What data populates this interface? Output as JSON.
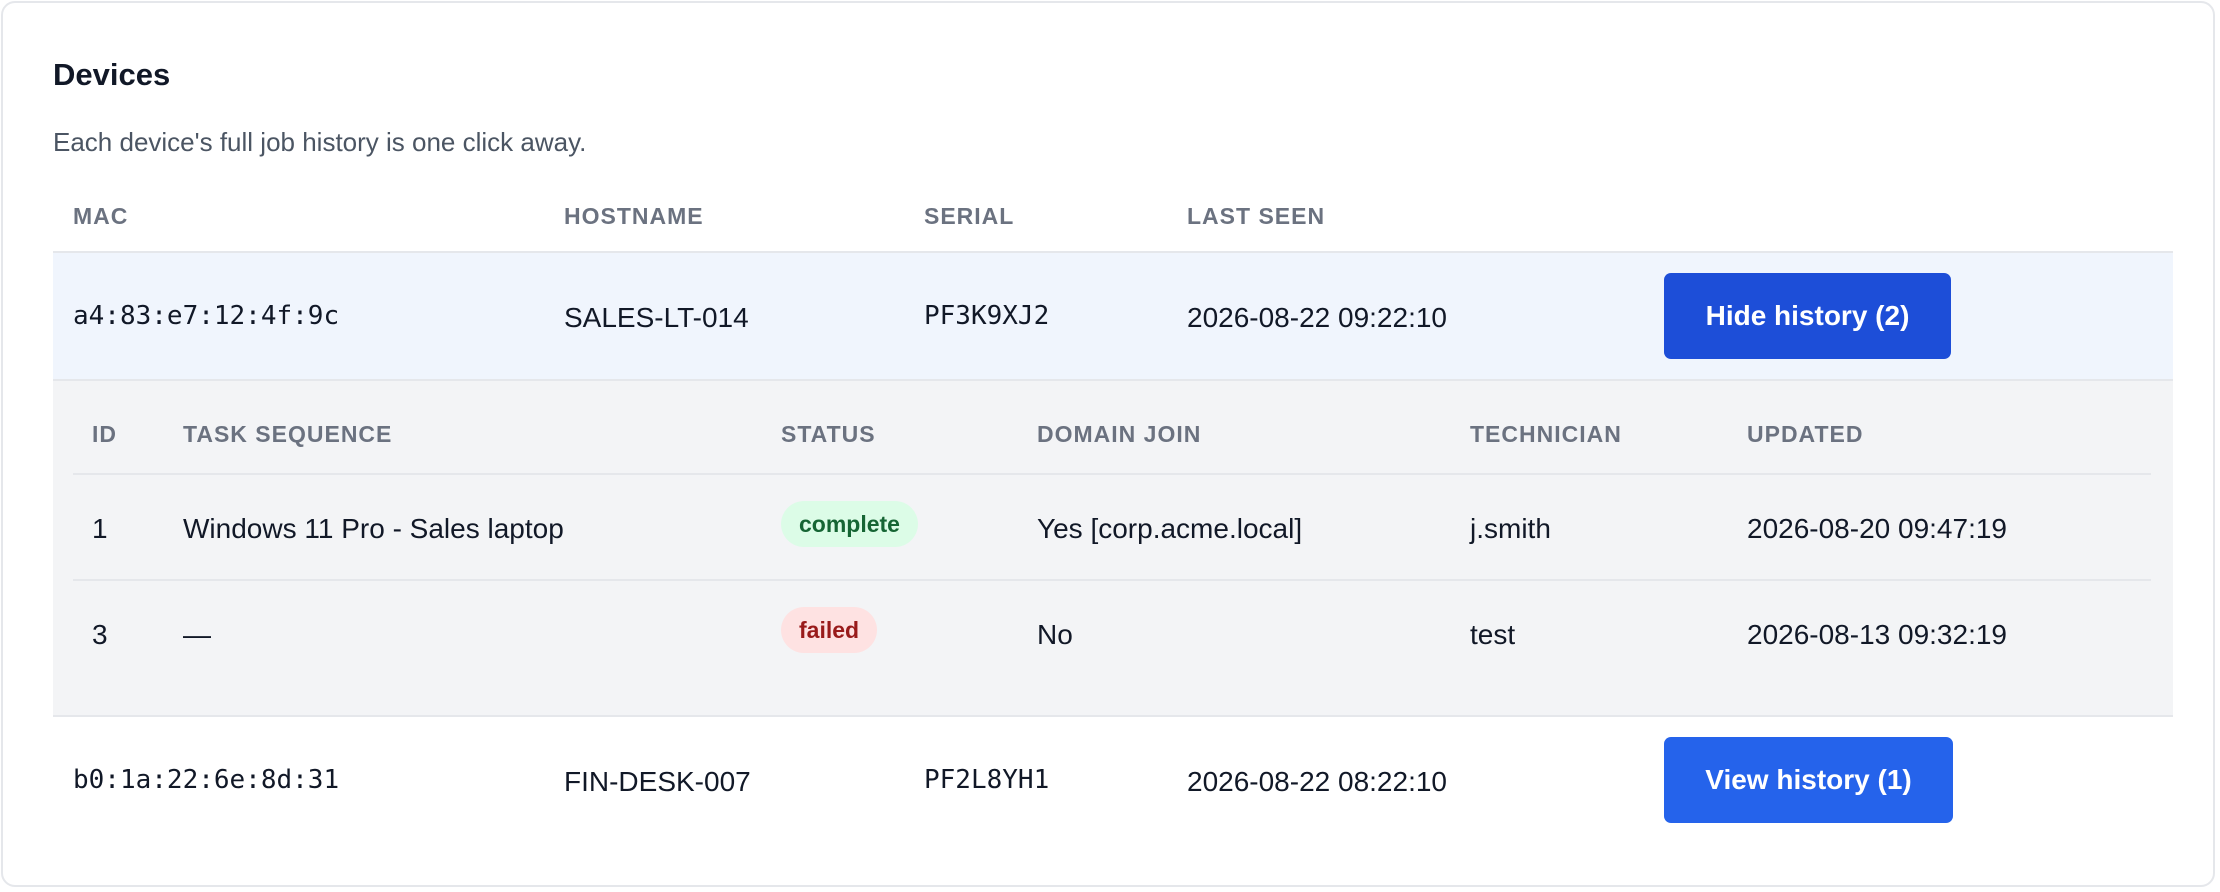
{
  "page": {
    "title": "Devices",
    "subtitle": "Each device's full job history is one click away."
  },
  "devices_table": {
    "columns": [
      "MAC",
      "HOSTNAME",
      "SERIAL",
      "LAST SEEN"
    ],
    "rows": [
      {
        "mac": "a4:83:e7:12:4f:9c",
        "hostname": "SALES-LT-014",
        "serial": "PF3K9XJ2",
        "last_seen": "2026-08-22 09:22:10",
        "action_label": "Hide history (2)",
        "expanded": true
      },
      {
        "mac": "b0:1a:22:6e:8d:31",
        "hostname": "FIN-DESK-007",
        "serial": "PF2L8YH1",
        "last_seen": "2026-08-22 08:22:10",
        "action_label": "View history (1)",
        "expanded": false
      }
    ]
  },
  "history_table": {
    "columns": [
      "ID",
      "TASK SEQUENCE",
      "STATUS",
      "DOMAIN JOIN",
      "TECHNICIAN",
      "UPDATED"
    ],
    "rows": [
      {
        "id": "1",
        "task_sequence": "Windows 11 Pro - Sales laptop",
        "status": "complete",
        "domain_join": "Yes [corp.acme.local]",
        "technician": "j.smith",
        "updated": "2026-08-20 09:47:19"
      },
      {
        "id": "3",
        "task_sequence": "—",
        "status": "failed",
        "domain_join": "No",
        "technician": "test",
        "updated": "2026-08-13 09:32:19"
      }
    ]
  },
  "colors": {
    "primary_button": "#2563eb",
    "primary_button_active": "#1d4ed8",
    "status_complete_bg": "#dcfce7",
    "status_complete_text": "#166534",
    "status_failed_bg": "#fee2e2",
    "status_failed_text": "#991b1b"
  }
}
